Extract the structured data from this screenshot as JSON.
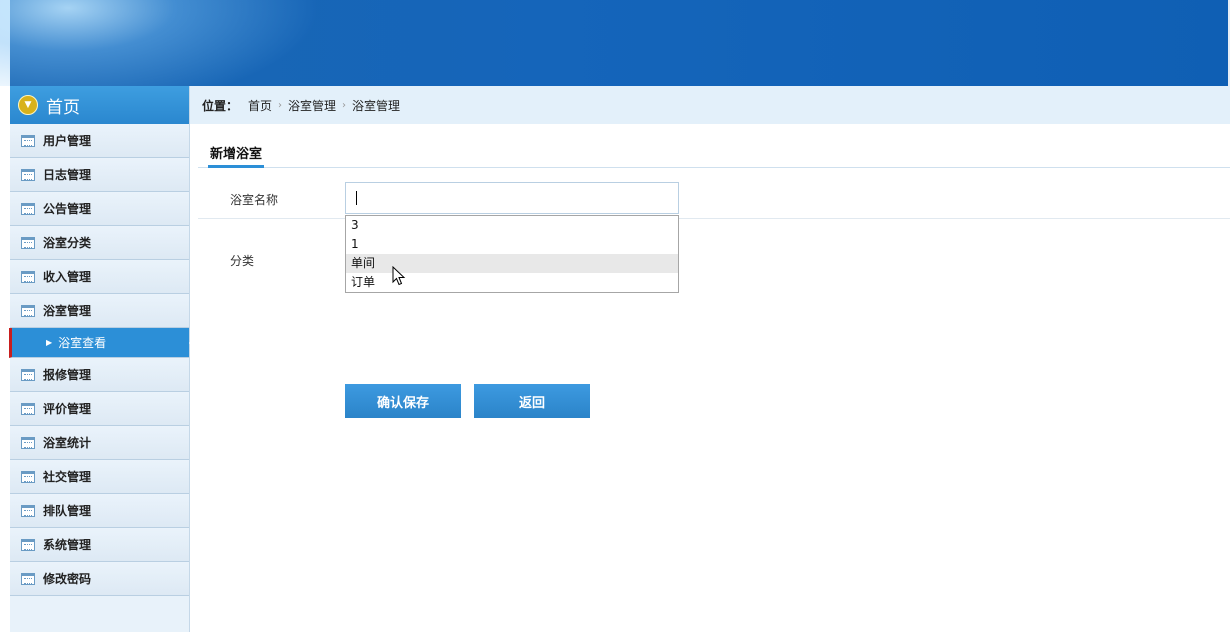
{
  "sidebar": {
    "home_label": "首页",
    "items": [
      {
        "label": "用户管理"
      },
      {
        "label": "日志管理"
      },
      {
        "label": "公告管理"
      },
      {
        "label": "浴室分类"
      },
      {
        "label": "收入管理"
      },
      {
        "label": "浴室管理"
      },
      {
        "label": "浴室查看",
        "sub": true,
        "active": true
      },
      {
        "label": "报修管理"
      },
      {
        "label": "评价管理"
      },
      {
        "label": "浴室统计"
      },
      {
        "label": "社交管理"
      },
      {
        "label": "排队管理"
      },
      {
        "label": "系统管理"
      },
      {
        "label": "修改密码"
      }
    ]
  },
  "breadcrumb": {
    "label": "位置：",
    "items": [
      "首页",
      "浴室管理",
      "浴室管理"
    ]
  },
  "form": {
    "tab_title": "新增浴室",
    "name_label": "浴室名称",
    "name_value": "",
    "category_label": "分类",
    "dropdown_options": [
      "3",
      "1",
      "单间",
      "订单"
    ],
    "hovered_option": "单间",
    "save_button": "确认保存",
    "back_button": "返回"
  },
  "colors": {
    "header_blue": "#1565ba",
    "accent_blue": "#2c8fd7",
    "active_marker": "#c81e1e"
  }
}
